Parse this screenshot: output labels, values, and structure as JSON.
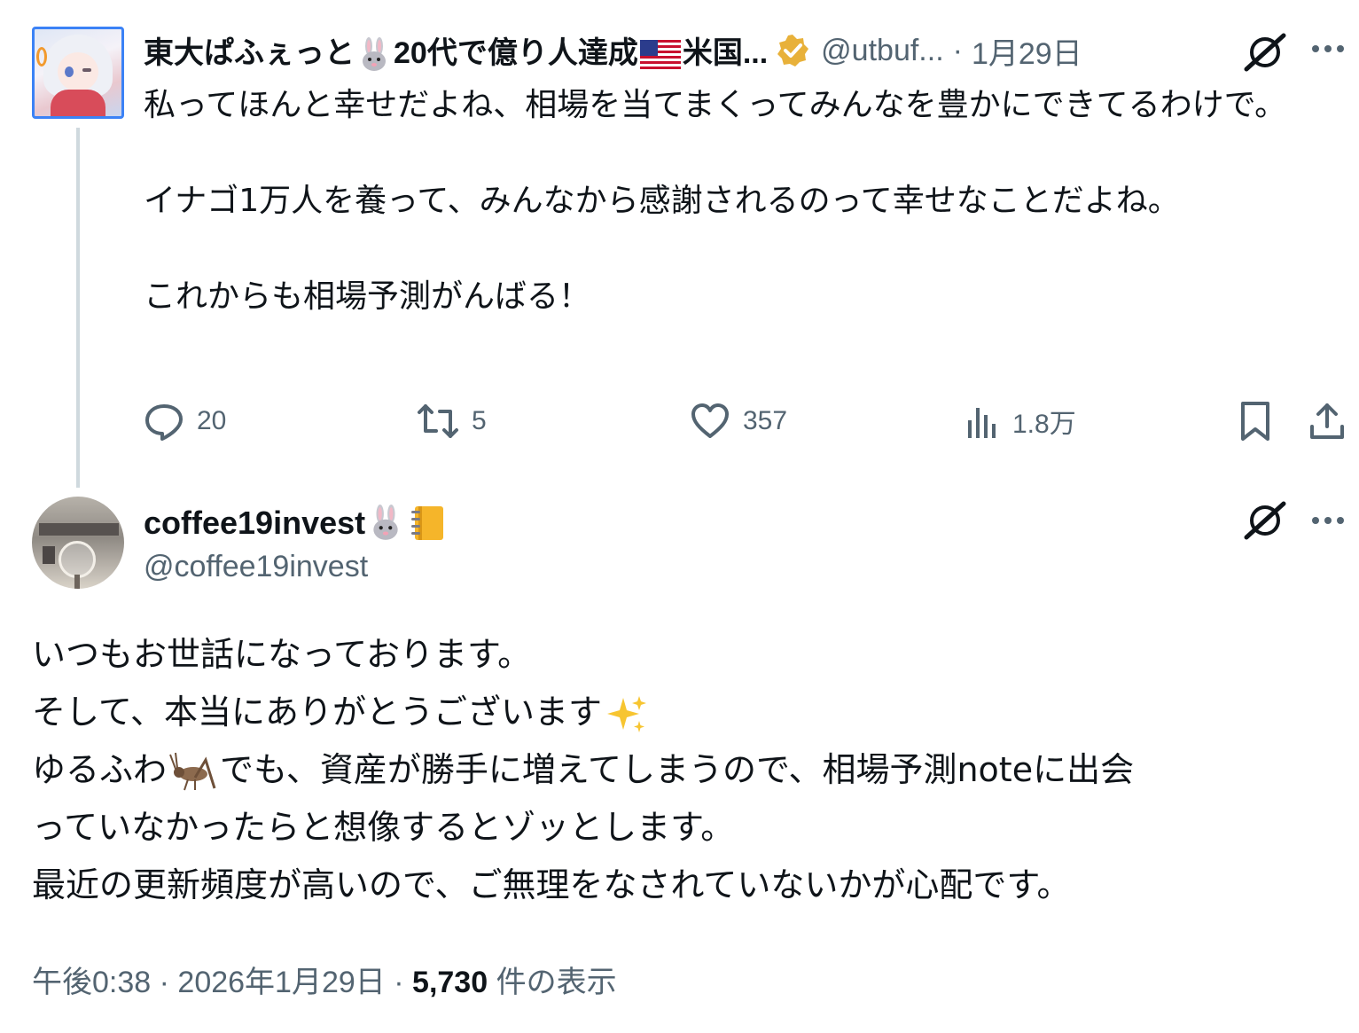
{
  "parent": {
    "display_name": "東大ぱふぇっと",
    "name_emoji_1": "rabbit-face",
    "name_middle": "20代で億り人達成",
    "name_emoji_2": "us-flag",
    "name_suffix": "米国...",
    "verified": true,
    "handle": "@utbuf...",
    "separator": "·",
    "date": "1月29日",
    "paragraphs": [
      "私ってほんと幸せだよね、相場を当てまくってみんなを豊かにできてるわけで。",
      "",
      "イナゴ1万人を養って、みんなから感謝されるのって幸せなことだよね。",
      "",
      "これからも相場予測がんばる！"
    ],
    "stats": {
      "replies": "20",
      "reposts": "5",
      "likes": "357",
      "views": "1.8万"
    },
    "icons": [
      "grok-icon",
      "more-icon",
      "reply-icon",
      "repost-icon",
      "like-icon",
      "views-icon",
      "bookmark-icon",
      "share-icon"
    ]
  },
  "reply": {
    "display_name": "coffee19invest",
    "name_emojis": [
      "rabbit-face",
      "notebook"
    ],
    "handle": "@coffee19invest",
    "lines": [
      "いつもお世話になっております。",
      "そして、本当にありがとうございます",
      "ゆるふわ",
      "でも、資産が勝手に増えてしまうので、相場予測noteに出会",
      "っていなかったらと想像するとゾッとします。",
      "最近の更新頻度が高いので、ご無理をなされていないかが心配です。"
    ],
    "inline_emojis": [
      "sparkles",
      "cricket"
    ],
    "meta": {
      "time": "午後0:38",
      "separator": "·",
      "date": "2026年1月29日",
      "views_count": "5,730",
      "views_label": "件の表示"
    }
  },
  "colors": {
    "text": "#0f1419",
    "secondary": "#536471",
    "thread_line": "#cfd9de",
    "verified_gold": "#e8b13a"
  }
}
